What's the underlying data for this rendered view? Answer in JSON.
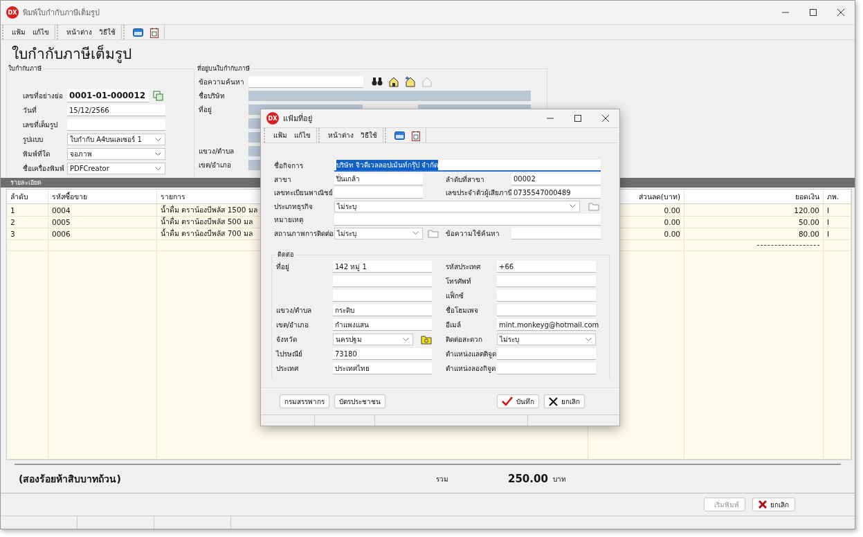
{
  "window": {
    "logo": "DX",
    "title": "พิมพ์ใบกำกับภาษีเต็มรูป"
  },
  "menu_groups": [
    [
      "แฟ้ม",
      "แก้ไข"
    ],
    [
      "หน้าต่าง",
      "วิธีใช้"
    ]
  ],
  "heading": "ใบกำกับภาษีเต็มรูป",
  "invoice_group": {
    "title": "ใบกำกับภาษี",
    "fields": [
      {
        "kind": "code",
        "label": "เลขที่อย่างย่อ",
        "value": "0001-01-000012"
      },
      {
        "kind": "text",
        "label": "วันที่",
        "value": "15/12/2566"
      },
      {
        "kind": "text",
        "label": "เลขที่เต็มรูป"
      },
      {
        "kind": "select",
        "label": "รูปแบบ",
        "value": "ใบกำกับ A4บนเลเซอร์ 1"
      },
      {
        "kind": "select",
        "label": "พิมพ์ที่ใด",
        "value": "จอภาพ"
      },
      {
        "kind": "select",
        "label": "ชื่อเครื่องพิมพ์",
        "value": "PDFCreator"
      }
    ]
  },
  "address_group": {
    "title": "ที่อยู่บนใบกำกับภาษี",
    "search_label": "ข้อความค้นหา",
    "rows": [
      {
        "kind": "full",
        "label": "ชื่อบริษัท"
      },
      {
        "kind": "split",
        "label": "ที่อยู่"
      },
      {
        "kind": "split"
      },
      {
        "kind": "split"
      },
      {
        "kind": "split",
        "label": "แขวง/ตำบล"
      },
      {
        "kind": "split",
        "label": "เขต/อำเภอ"
      }
    ]
  },
  "details": {
    "title": "รายละเอียด",
    "columns": [
      "ลำดับ",
      "รหัสซื้อขาย",
      "รายการ",
      "ส่วนลด(บาท)",
      "ยอดเงิน",
      "ภพ."
    ],
    "rows": [
      [
        "1",
        "0004",
        "น้ำดื่ม ตราน้องบีพลัส 1500 มล",
        "0.00",
        "120.00",
        "I"
      ],
      [
        "2",
        "0005",
        "น้ำดื่ม ตราน้องบีพลัส 500 มล",
        "0.00",
        "50.00",
        "I"
      ],
      [
        "3",
        "0006",
        "น้ำดื่ม ตราน้องบีพลัส 700 มล",
        "0.00",
        "80.00",
        "I"
      ]
    ]
  },
  "total": {
    "words": "(สองร้อยห้าสิบบาทถ้วน)",
    "label": "รวม",
    "amount": "250.00",
    "unit": "บาท"
  },
  "buttons": [
    {
      "kind": "print",
      "label": "เริ่มพิมพ์",
      "disabled": true
    },
    {
      "kind": "cancel",
      "label": "ยกเลิก",
      "disabled": false
    }
  ],
  "dialog": {
    "logo": "DX",
    "title": "แฟ้มที่อยู่",
    "menu_groups": [
      [
        "แฟ้ม",
        "แก้ไข"
      ],
      [
        "หน้าต่าง",
        "วิธีใช้"
      ]
    ],
    "top_rows": [
      {
        "kind": "wide",
        "label": "ชื่อกิจการ",
        "value": "บริษัท จิวดีเวลลอปเม้นท์กรุ๊ป จำกัด",
        "selected": true
      },
      {
        "kind": "pair",
        "label": "สาขา",
        "value": "ปิ่นเกล้า",
        "label2": "ลำดับที่สาขา",
        "value2": "00002"
      },
      {
        "kind": "pair",
        "label": "เลขทะเบียนพาณิชย์",
        "label2": "เลขประจำตัวผู้เสียภาษี",
        "value2": "0735547000489"
      },
      {
        "kind": "wide_select",
        "label": "ประเภทธุรกิจ",
        "value": "ไม่ระบุ"
      },
      {
        "kind": "wide",
        "label": "หมายเหตุ",
        "selected": false
      },
      {
        "kind": "select_pair",
        "label": "สถานภาพการติดต่อ",
        "value": "ไม่ระบุ",
        "label2": "ข้อความใช้ค้นหา"
      }
    ],
    "contact": {
      "title": "ติดต่อ",
      "left": [
        {
          "kind": "text",
          "label": "ที่อยู่",
          "value": "142 หมู่ 1"
        },
        {
          "kind": "text"
        },
        {
          "kind": "text"
        },
        {
          "kind": "text",
          "label": "แขวง/ตำบล",
          "value": "กระดิบ"
        },
        {
          "kind": "text",
          "label": "เขต/อำเภอ",
          "value": "กำแพงแสน"
        },
        {
          "kind": "select",
          "label": "จังหวัด",
          "value": "นครปฐม"
        },
        {
          "kind": "text",
          "label": "ไปรษณีย์",
          "value": "73180"
        },
        {
          "kind": "text",
          "label": "ประเทศ",
          "value": "ประเทศไทย"
        }
      ],
      "right": [
        {
          "kind": "text",
          "label": "รหัสประเทศ",
          "value": "+66"
        },
        {
          "kind": "text",
          "label": "โทรศัพท์"
        },
        {
          "kind": "text",
          "label": "แฟ็กซ์"
        },
        {
          "kind": "text",
          "label": "ชื่อโฮมเพจ"
        },
        {
          "kind": "text",
          "label": "อีเมล์",
          "value": "mint.monkeyg@hotmail.com"
        },
        {
          "kind": "select",
          "label": "ติดต่อสะดวก",
          "value": "ไม่ระบุ"
        },
        {
          "kind": "text",
          "label": "ตำแหน่งแลตติจูด"
        },
        {
          "kind": "text",
          "label": "ตำแหน่งลองกิจูด"
        }
      ]
    },
    "left_buttons": [
      "กรมสรรพากร",
      "บัตรประชาชน"
    ],
    "right_buttons": [
      {
        "kind": "save",
        "label": "บันทึก"
      },
      {
        "kind": "cancel",
        "label": "ยกเลิก"
      }
    ]
  }
}
